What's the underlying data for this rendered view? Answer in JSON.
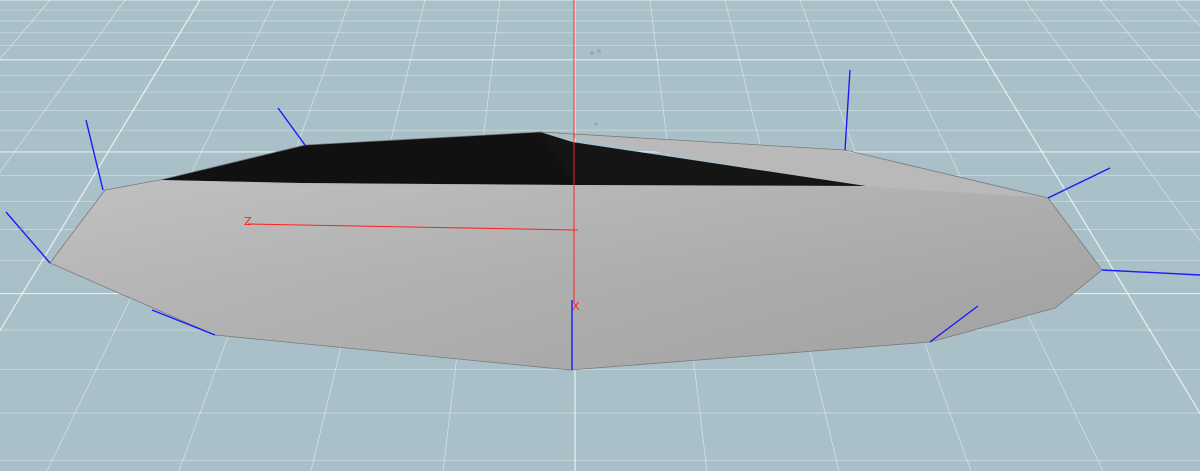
{
  "viewport": {
    "background_color": "#a9c0c8",
    "grid_color": "#ffffff",
    "mesh_light_color": "#c4c4c4",
    "mesh_mid_color": "#a8a8a8",
    "mesh_dark_color": "#111111",
    "normal_color": "#1a1aff",
    "axis_color": "#ff2020"
  },
  "axes": {
    "z_label": "Z",
    "x_label": "X"
  }
}
